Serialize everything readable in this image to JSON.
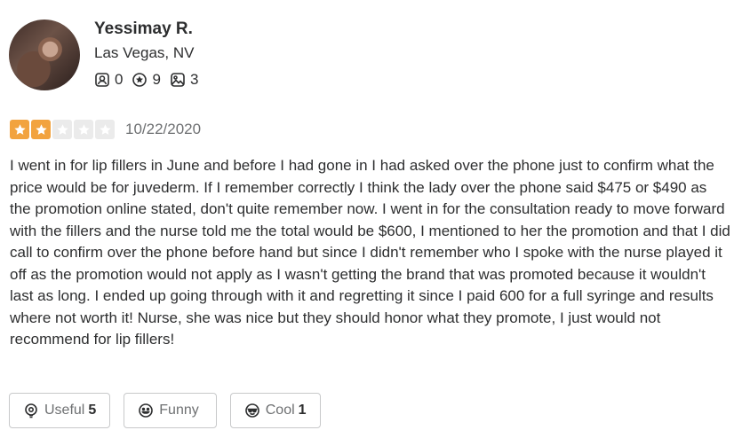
{
  "user": {
    "name": "Yessimay R.",
    "location": "Las Vegas, NV",
    "stats": [
      {
        "icon": "friends-icon",
        "value": "0"
      },
      {
        "icon": "reviews-icon",
        "value": "9"
      },
      {
        "icon": "photos-icon",
        "value": "3"
      }
    ]
  },
  "review": {
    "rating": 2,
    "max_rating": 5,
    "date": "10/22/2020",
    "text": "I went in for lip fillers in June and before I had gone in I had asked over the phone just to confirm what the price would be for juvederm. If I remember correctly I think the lady over the phone said $475 or $490 as the promotion online stated, don't quite remember now. I went in for the consultation ready to move forward with the fillers and the nurse told me the total would be $600, I mentioned to her the promotion and that I did call to confirm over the phone before hand but since I didn't remember who I spoke with the nurse played it off as the promotion would not apply as I wasn't getting the brand that was promoted because it wouldn't last as long. I ended up going through with it and regretting it since I paid 600 for a full syringe and results where not worth it! Nurse, she was nice but they should honor what they promote, I just would not recommend for lip fillers!"
  },
  "actions": {
    "useful": {
      "label": "Useful",
      "count": "5"
    },
    "funny": {
      "label": "Funny",
      "count": ""
    },
    "cool": {
      "label": "Cool",
      "count": "1"
    }
  },
  "colors": {
    "star_filled": "#f2a33f",
    "star_empty": "#ebebeb",
    "text": "#2d2e2f",
    "muted": "#6e7072",
    "border": "#c8c9ca"
  }
}
